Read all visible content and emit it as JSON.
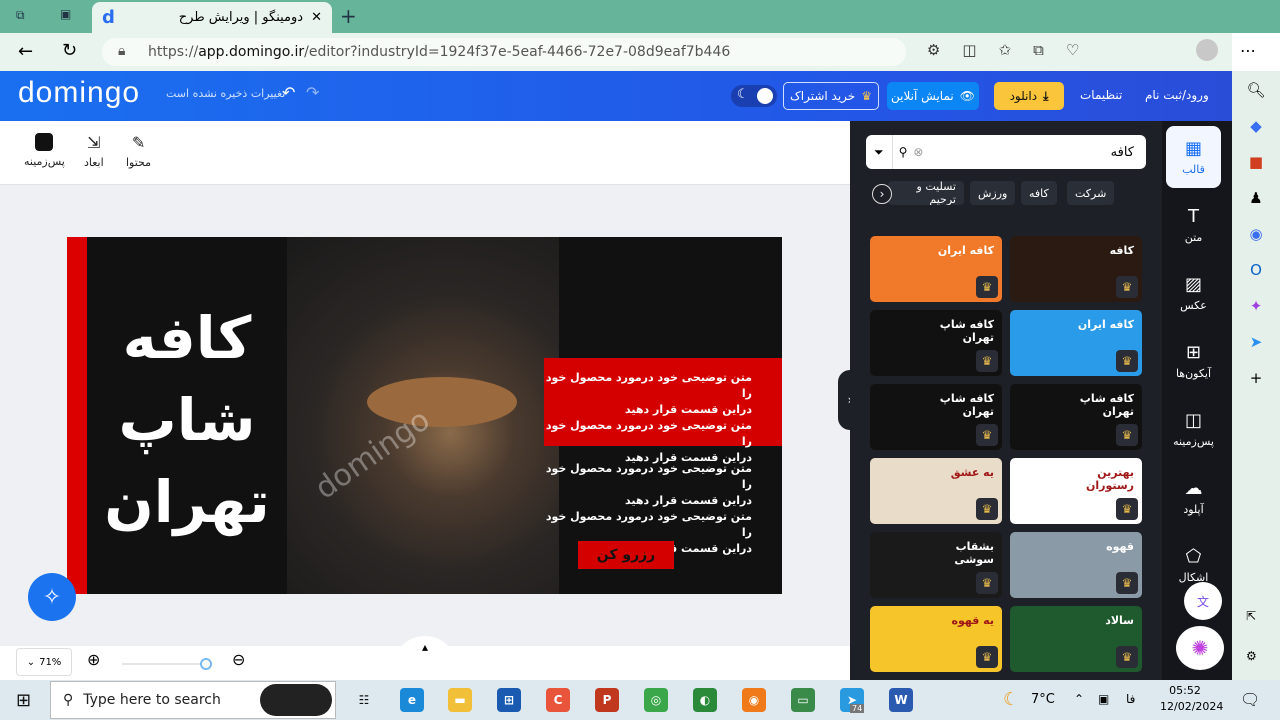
{
  "browser": {
    "tab_title": "دومینگو | ویرایش طرح",
    "url_prefix": "https://",
    "url_host": "app.domingo.ir",
    "url_path": "/editor?industryId=1924f37e-5eaf-4466-72e7-08d9eaf7b446"
  },
  "header": {
    "logo": "domingo",
    "save_status": "تغییرات ذخیره نشده است",
    "login": "ورود/ثبت نام",
    "settings": "تنظیمات",
    "download": "دانلود",
    "preview": "نمایش آنلاین",
    "subscribe": "خرید اشتراک"
  },
  "toolbar": {
    "content": "محتوا",
    "dimensions": "ابعاد",
    "background": "پس‌زمینه"
  },
  "design": {
    "title_lines": [
      "کافه",
      "شاپ",
      "تهران"
    ],
    "red_text": "متن توضیحی خود درمورد محصول خود را\nدراین قسمت قرار دهید\nمتن توضیحی خود درمورد محصول خود را\nدراین قسمت قرار دهید",
    "dark_text": "متن توضیحی خود درمورد محصول خود را\nدراین قسمت قرار دهید\nمتن توضیحی خود درمورد محصول خود را\nدراین قسمت قرار دهید",
    "cta": "رزرو کن",
    "watermark": "domingo"
  },
  "zoom": {
    "level": "71%",
    "value": 71
  },
  "panel": {
    "search_value": "کافه",
    "chips": [
      "شرکت",
      "کافه",
      "ورزش",
      "تسلیت و ترحیم"
    ],
    "thumbs": [
      {
        "bg": "#f07a2a",
        "text": "کافه ایران"
      },
      {
        "bg": "#2a1a12",
        "text": "کافه"
      },
      {
        "bg": "#111",
        "text": "کافه شاپ تهران"
      },
      {
        "bg": "#2a9be8",
        "text": "کافه ایران"
      },
      {
        "bg": "#111",
        "text": "کافه شاپ تهران"
      },
      {
        "bg": "#111",
        "text": "کافه شاپ تهران"
      },
      {
        "bg": "#e9dcc8",
        "text": "یه عشق"
      },
      {
        "bg": "#fff",
        "text": "بهترین رستوران"
      },
      {
        "bg": "#1a1a1a",
        "text": "بشقاب سوشی"
      },
      {
        "bg": "#8a9aa6",
        "text": "قهوه"
      },
      {
        "bg": "#f6c529",
        "text": "یه قهوه"
      },
      {
        "bg": "#1f5a2e",
        "text": "سالاد"
      }
    ]
  },
  "sidebar": {
    "items": [
      "قالب",
      "متن",
      "عکس",
      "آیکون‌ها",
      "پس‌زمینه",
      "آپلود",
      "اشکال"
    ]
  },
  "taskbar": {
    "search_placeholder": "Type here to search",
    "temp": "7°C",
    "lang": "فا",
    "time": "05:52",
    "date": "12/02/2024",
    "badge": "74"
  }
}
